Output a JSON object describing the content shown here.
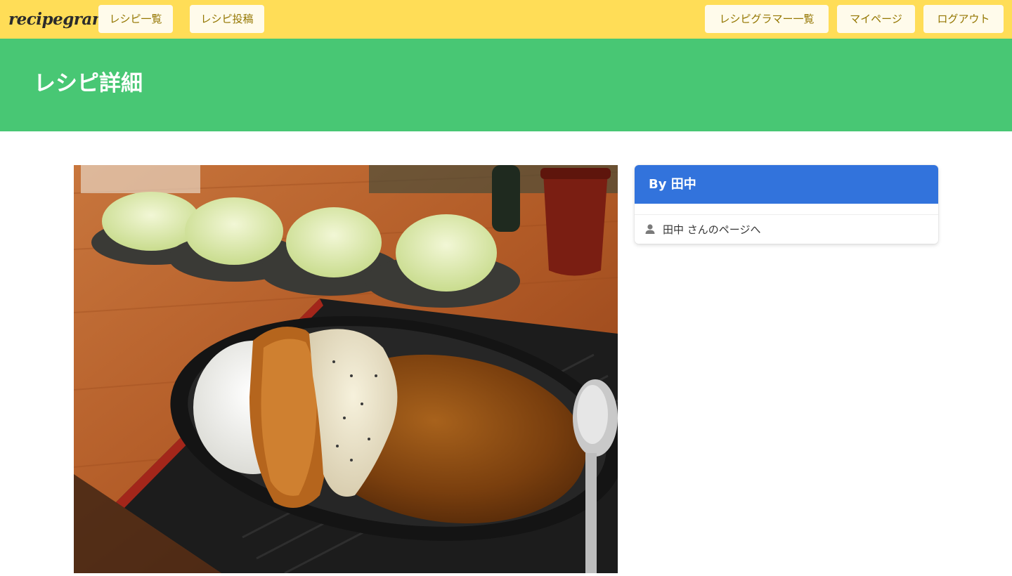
{
  "navbar": {
    "brand": "recipegram",
    "left_items": [
      "レシピ一覧",
      "レシピ投稿"
    ],
    "right_items": [
      "レシピグラマー一覧",
      "マイページ",
      "ログアウト"
    ]
  },
  "hero": {
    "title": "レシピ詳細"
  },
  "author_card": {
    "header": "By 田中",
    "link_label": "田中 さんのページへ",
    "link_icon": "user-icon"
  },
  "colors": {
    "navbar": "#ffdd57",
    "nav_button_bg": "#fffbeb",
    "nav_button_text": "#947600",
    "hero": "#48c774",
    "card_header": "#3273dc"
  }
}
